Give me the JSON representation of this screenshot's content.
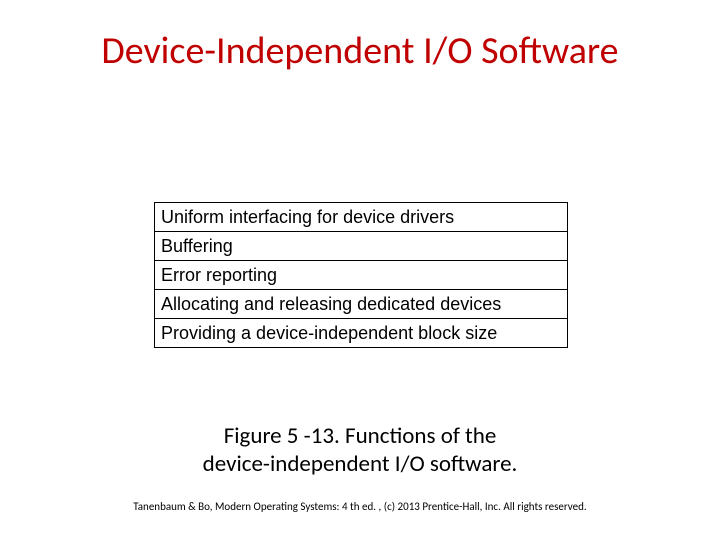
{
  "title": "Device-Independent I/O Software",
  "rows": [
    "Uniform interfacing for device drivers",
    "Buffering",
    "Error reporting",
    "Allocating and releasing dedicated devices",
    "Providing a device-independent block size"
  ],
  "caption_line1": "Figure 5 -13. Functions of the",
  "caption_line2": "device-independent I/O software.",
  "footer": "Tanenbaum & Bo, Modern  Operating Systems: 4 th ed. , (c) 2013 Prentice-Hall, Inc. All rights reserved."
}
